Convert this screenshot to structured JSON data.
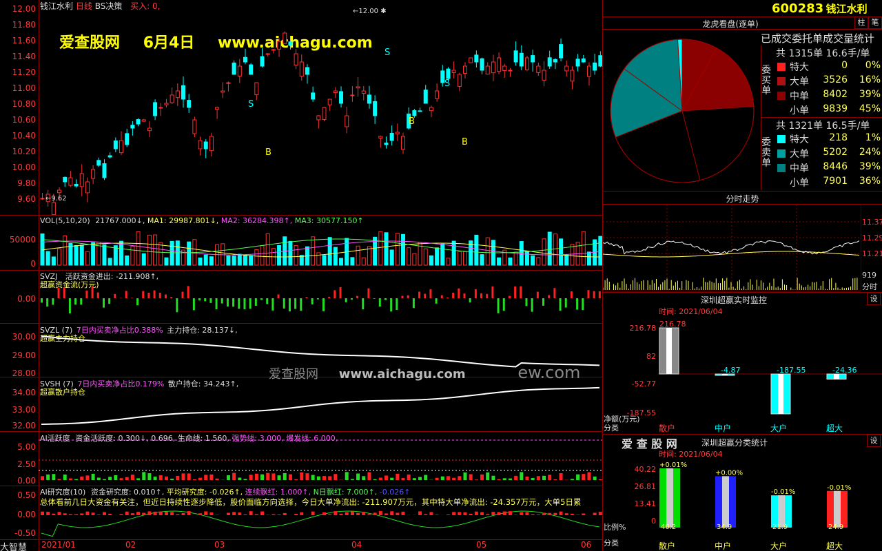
{
  "header": {
    "stock_name": "钱江水利",
    "line_type": "日线",
    "indicator": "BS决策",
    "signal": "买入: 0,",
    "code": "600283",
    "code_name": "钱江水利"
  },
  "watermark": {
    "site": "爱查股网",
    "date": "6月4日",
    "url": "www.aichagu.com",
    "mid_site": "爱查股网",
    "mid_url": "www.aichagu.com",
    "mid_tail": "ew.com"
  },
  "main_chart": {
    "y_labels": [
      "12.00",
      "11.80",
      "11.60",
      "11.40",
      "11.20",
      "11.00",
      "10.80",
      "10.60",
      "10.40",
      "10.20",
      "10.00",
      "9.80",
      "9.60"
    ],
    "high_label": "12.00",
    "low_label": "9.62"
  },
  "vol_panel": {
    "title": "VOL(5,10,20)",
    "vol": "21767.000↓,",
    "ma1": "MA1: 29987.801↓,",
    "ma2": "MA2: 36284.398↑,",
    "ma3": "MA3: 30577.150↑",
    "y_labels": [
      "50000",
      "0"
    ]
  },
  "svzj_panel": {
    "title": "SVZJ",
    "line1": "活跃资金进出: -211.908↑,",
    "line2": "超赢资金流(万元)",
    "y_label": "0.00"
  },
  "svzl_panel": {
    "title": "SVZL (7)",
    "desc": "7日内买卖净占比0.388%",
    "value": "主力持仓: 28.137↓,",
    "line2": "超赢主力持仓",
    "y_labels": [
      "30.00",
      "29.00",
      "28.00"
    ]
  },
  "svsh_panel": {
    "title": "SVSH (7)",
    "desc": "7日内买卖净占比0.179%",
    "value": "散户持仓: 34.243↑,",
    "line2": "超赢散户持仓",
    "y_labels": [
      "34.00",
      "33.00",
      "32.00"
    ]
  },
  "ai_active_panel": {
    "title": "AI活跃度",
    "v1": "资金活跃度: 0.300↓,",
    "v2": "0.696,",
    "v3": "生命线: 1.560,",
    "v4": "强势线: 3.000,",
    "v5": "爆发线: 6.000,",
    "y_labels": [
      "5.00",
      "2.50",
      "0.00"
    ]
  },
  "ai_research_panel": {
    "title": "AI研究度(10)",
    "v1": "资金研究度: 0.010↑,",
    "v2": "平均研究度: -0.026↑,",
    "v3": "连续飘红: 1.000↑,",
    "v4": "N日飘红: 7.000↑,",
    "v5": "-0.026↑",
    "summary": "总体看前几日大资金有关注，但近日持续性逐步降低，股价面临方向选择，今日大单净流出: -211.907万元，其中特大单净流出: -24.357万元，大单5日累",
    "y_labels": [
      "0.50",
      "0.00",
      "-0.50"
    ]
  },
  "x_axis": {
    "corner": "大智慧",
    "labels": [
      "2021/01",
      "02",
      "03",
      "04",
      "05",
      "06"
    ]
  },
  "buttons": {
    "zhu": "柱",
    "bi": "笔",
    "she1": "设",
    "she2": "设"
  },
  "pie_panel": {
    "title": "龙虎看盘(逐单)",
    "subtitle": "已成交委托单成交量统计",
    "buy_label": "委买单",
    "sell_label": "委卖单",
    "buy_total": "共 1315单 16.6手/单",
    "sell_total": "共 1321单 16.5手/单",
    "buy_rows": [
      {
        "name": "特大",
        "value": "0",
        "pct": "0%",
        "color": "#ff2020"
      },
      {
        "name": "大单",
        "value": "3526",
        "pct": "16%",
        "color": "#b01010"
      },
      {
        "name": "中单",
        "value": "8402",
        "pct": "39%",
        "color": "#8b0000"
      },
      {
        "name": "小单",
        "value": "9839",
        "pct": "45%",
        "color": "#000000"
      }
    ],
    "sell_rows": [
      {
        "name": "特大",
        "value": "218",
        "pct": "1%",
        "color": "#00ffff"
      },
      {
        "name": "大单",
        "value": "5202",
        "pct": "24%",
        "color": "#00a0a0"
      },
      {
        "name": "中单",
        "value": "8446",
        "pct": "39%",
        "color": "#008080"
      },
      {
        "name": "小单",
        "value": "7901",
        "pct": "36%",
        "color": "#000000"
      }
    ]
  },
  "intraday_panel": {
    "title": "分时走势",
    "y_labels": [
      "11.37",
      "11.29",
      "11.21"
    ],
    "vol_label": "919",
    "vol_unit": "分时"
  },
  "realtime_panel": {
    "title": "深圳超赢实时监控",
    "time": "时间: 2021/06/04",
    "y_labels": [
      "216.78",
      "82",
      "-52.77",
      "-187.55"
    ],
    "unit": "净额(万元)",
    "cat_label": "分类",
    "categories": [
      "散户",
      "中户",
      "大户",
      "超大"
    ],
    "values": [
      216.78,
      -4.87,
      -187.55,
      -24.36
    ],
    "value_labels": [
      "216.78",
      "-4.87",
      "-187.55",
      "-24.36"
    ]
  },
  "class_panel": {
    "logo": "爱 查 股 网",
    "title": "深圳超赢分类统计",
    "time": "时间: 2021/06/04",
    "y_labels": [
      "40.22",
      "26.81",
      "13.41",
      "0"
    ],
    "ratio_label": "比例%",
    "cat_label": "分类",
    "categories": [
      "散户",
      "中户",
      "大户",
      "超大"
    ],
    "values": [
      40.2,
      34.9,
      21.9,
      24.9
    ],
    "top_labels": [
      "+0.01%",
      "+0.00%",
      "-0.01%",
      "-0.01%"
    ],
    "colors": [
      "#00dd00",
      "#2020ff",
      "#00ffff",
      "#ff2020"
    ]
  }
}
